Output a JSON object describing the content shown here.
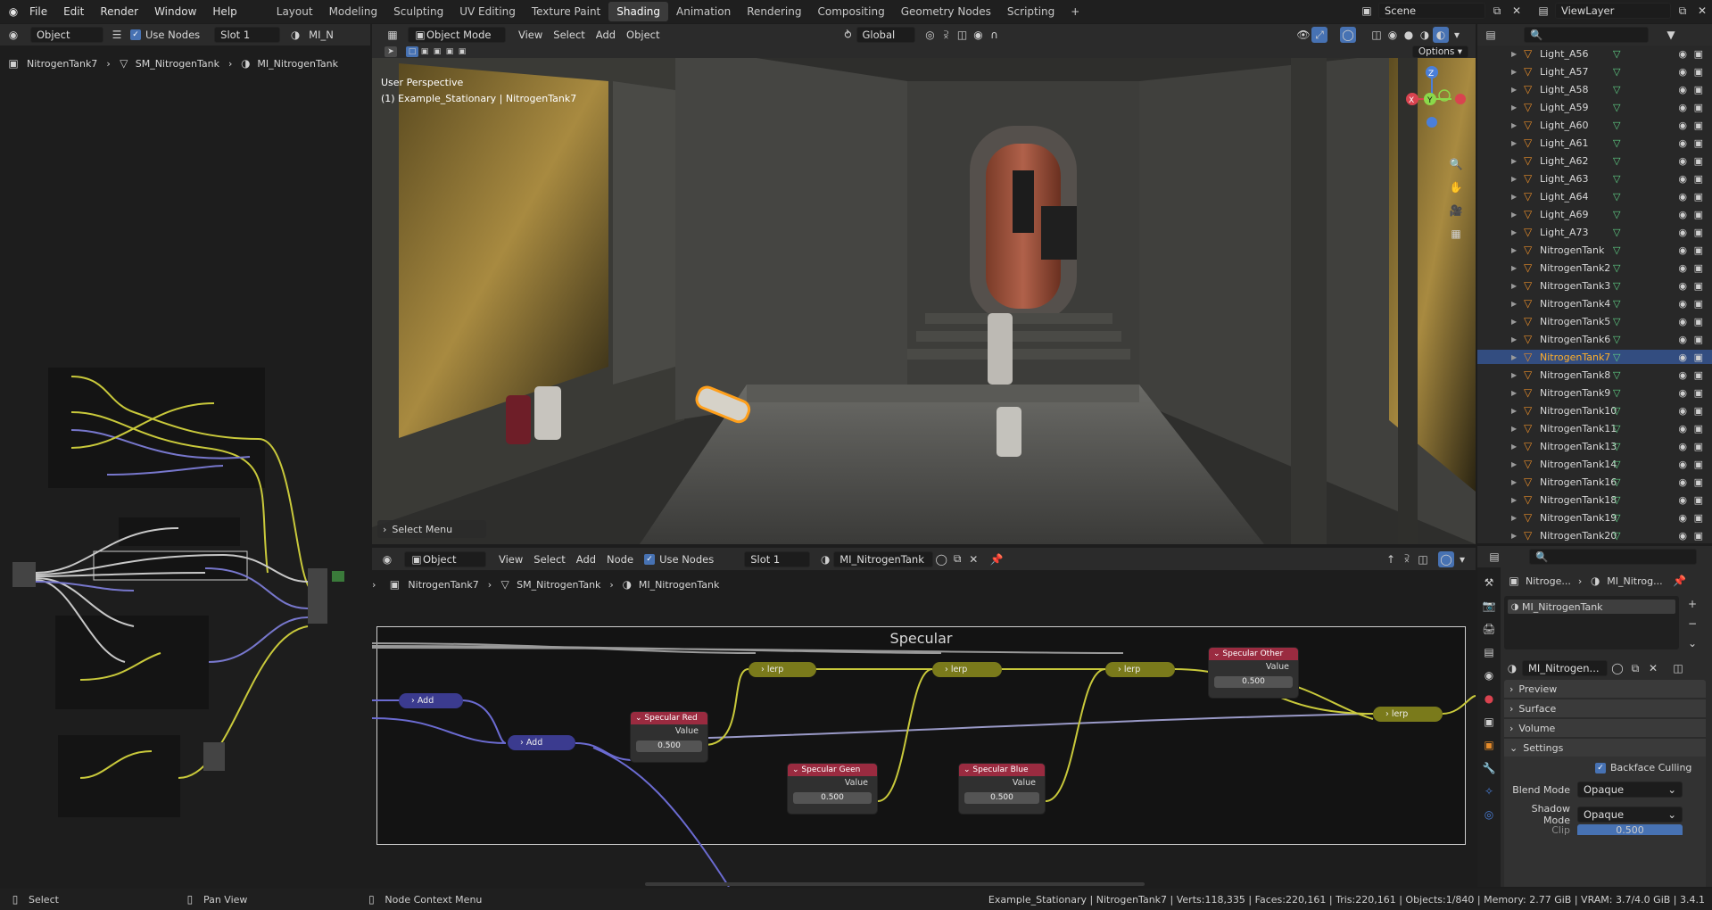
{
  "topbar": {
    "menus": [
      "File",
      "Edit",
      "Render",
      "Window",
      "Help"
    ],
    "workspaces": [
      "Layout",
      "Modeling",
      "Sculpting",
      "UV Editing",
      "Texture Paint",
      "Shading",
      "Animation",
      "Rendering",
      "Compositing",
      "Geometry Nodes",
      "Scripting"
    ],
    "active_workspace": "Shading",
    "add_tab": "+",
    "scene": "Scene",
    "view_layer": "ViewLayer"
  },
  "left_editor": {
    "object_dd": "Object",
    "use_nodes": "Use Nodes",
    "slot": "Slot 1",
    "material_short": "MI_N",
    "breadcrumb": [
      "NitrogenTank7",
      "SM_NitrogenTank",
      "MI_NitrogenTank"
    ]
  },
  "viewport": {
    "mode": "Object Mode",
    "menus": [
      "View",
      "Select",
      "Add",
      "Object"
    ],
    "transform": "Global",
    "options": "Options",
    "perspective": "User Perspective",
    "collection": "(1) Example_Stationary | NitrogenTank7",
    "last_op": "Select Menu",
    "gizmo": {
      "x": "X",
      "y": "Y",
      "z": "Z"
    }
  },
  "outliner": {
    "items": [
      {
        "name": "Light_A56",
        "selected": false
      },
      {
        "name": "Light_A57",
        "selected": false
      },
      {
        "name": "Light_A58",
        "selected": false
      },
      {
        "name": "Light_A59",
        "selected": false
      },
      {
        "name": "Light_A60",
        "selected": false
      },
      {
        "name": "Light_A61",
        "selected": false
      },
      {
        "name": "Light_A62",
        "selected": false
      },
      {
        "name": "Light_A63",
        "selected": false
      },
      {
        "name": "Light_A64",
        "selected": false
      },
      {
        "name": "Light_A69",
        "selected": false
      },
      {
        "name": "Light_A73",
        "selected": false
      },
      {
        "name": "NitrogenTank",
        "selected": false
      },
      {
        "name": "NitrogenTank2",
        "selected": false
      },
      {
        "name": "NitrogenTank3",
        "selected": false
      },
      {
        "name": "NitrogenTank4",
        "selected": false
      },
      {
        "name": "NitrogenTank5",
        "selected": false
      },
      {
        "name": "NitrogenTank6",
        "selected": false
      },
      {
        "name": "NitrogenTank7",
        "selected": true
      },
      {
        "name": "NitrogenTank8",
        "selected": false
      },
      {
        "name": "NitrogenTank9",
        "selected": false
      },
      {
        "name": "NitrogenTank10",
        "selected": false
      },
      {
        "name": "NitrogenTank11",
        "selected": false
      },
      {
        "name": "NitrogenTank13",
        "selected": false
      },
      {
        "name": "NitrogenTank14",
        "selected": false
      },
      {
        "name": "NitrogenTank16",
        "selected": false
      },
      {
        "name": "NitrogenTank18",
        "selected": false
      },
      {
        "name": "NitrogenTank19",
        "selected": false
      },
      {
        "name": "NitrogenTank20",
        "selected": false
      }
    ]
  },
  "node_editor": {
    "object_dd": "Object",
    "menus": [
      "View",
      "Select",
      "Add",
      "Node"
    ],
    "use_nodes": "Use Nodes",
    "slot": "Slot 1",
    "material": "MI_NitrogenTank",
    "breadcrumb": [
      "NitrogenTank7",
      "SM_NitrogenTank",
      "MI_NitrogenTank"
    ],
    "frame_label": "Specular",
    "nodes": {
      "add1": "Add",
      "add2": "Add",
      "lerp1": "lerp",
      "lerp2": "lerp",
      "lerp3": "lerp",
      "lerp4": "lerp",
      "spec_red": {
        "title": "Specular Red",
        "label": "Value",
        "value": "0.500"
      },
      "spec_green": {
        "title": "Specular Geen",
        "label": "Value",
        "value": "0.500"
      },
      "spec_blue": {
        "title": "Specular Blue",
        "label": "Value",
        "value": "0.500"
      },
      "spec_other": {
        "title": "Specular Other",
        "label": "Value",
        "value": "0.500"
      }
    }
  },
  "properties": {
    "breadcrumb": [
      "Nitroge...",
      "MI_Nitrog..."
    ],
    "slot_item": "MI_NitrogenTank",
    "material_field": "MI_Nitrogen...",
    "panels": [
      "Preview",
      "Surface",
      "Volume",
      "Settings"
    ],
    "backface": "Backface Culling",
    "blend_mode_label": "Blend Mode",
    "blend_mode": "Opaque",
    "shadow_mode_label": "Shadow Mode",
    "shadow_mode": "Opaque",
    "clip_label": "Clip Threshold",
    "clip_value": "0.500"
  },
  "statusbar": {
    "select": "Select",
    "pan": "Pan View",
    "context": "Node Context Menu",
    "stats": "Example_Stationary | NitrogenTank7 | Verts:118,335 | Faces:220,161 | Tris:220,161 | Objects:1/840 | Memory: 2.77 GiB | VRAM: 3.7/4.0 GiB | 3.4.1"
  }
}
